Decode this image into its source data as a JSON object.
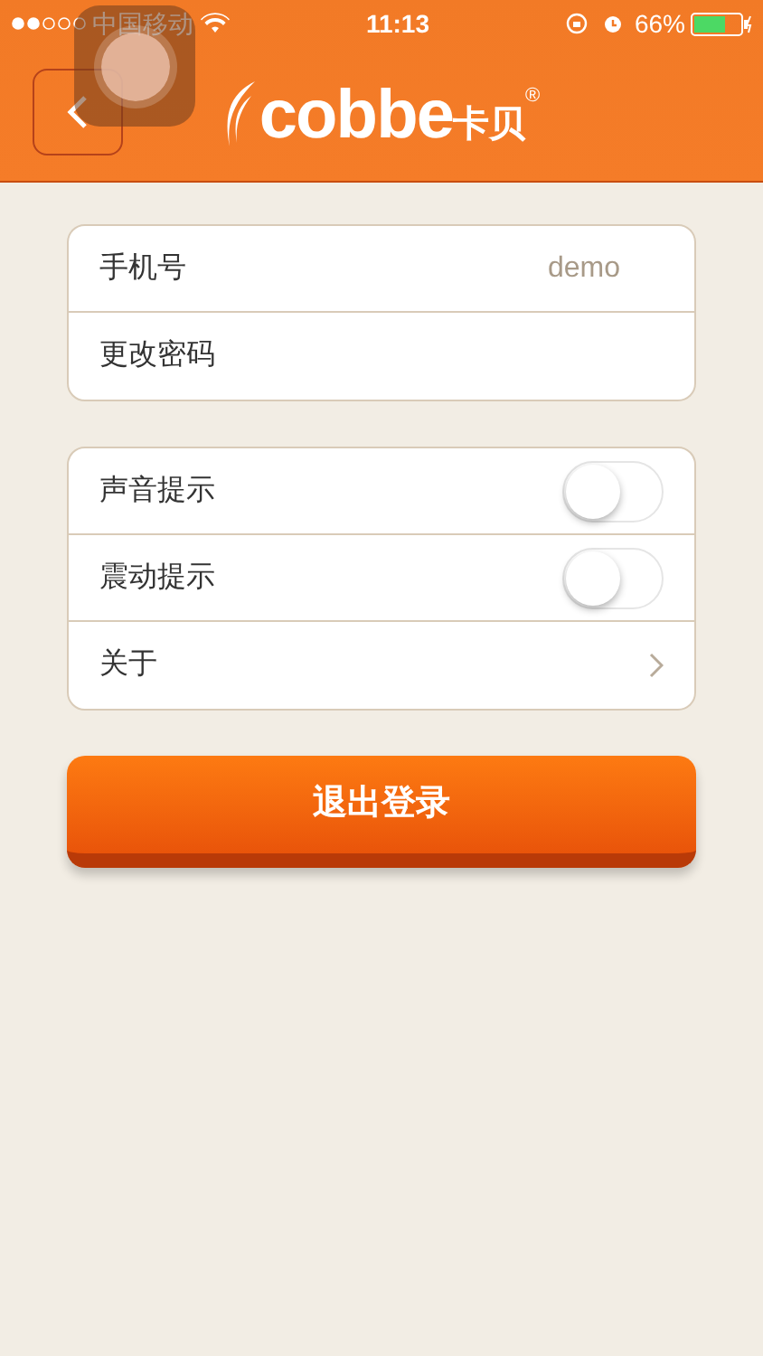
{
  "status_bar": {
    "carrier": "中国移动",
    "time": "11:13",
    "battery": "66%"
  },
  "header": {
    "logo": "cobbe",
    "logo_cn": "卡贝",
    "registered": "®"
  },
  "account_group": [
    {
      "kind": "value",
      "label": "手机号",
      "value": "demo"
    },
    {
      "kind": "plain",
      "label": "更改密码"
    }
  ],
  "settings_group": [
    {
      "kind": "toggle",
      "label": "声音提示",
      "on": false
    },
    {
      "kind": "toggle",
      "label": "震动提示",
      "on": false
    },
    {
      "kind": "disclosure",
      "label": "关于"
    }
  ],
  "logout_button": "退出登录"
}
